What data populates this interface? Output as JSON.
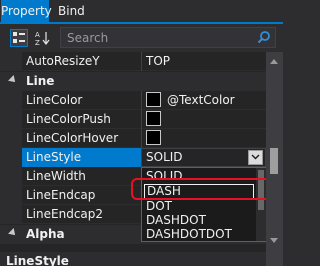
{
  "tabs": [
    {
      "label": "Property",
      "active": true
    },
    {
      "label": "Bind",
      "active": false
    }
  ],
  "toolbar": {
    "categorized_icon": "categorized-view-icon",
    "alphabetical_icon": "sort-alphabetical-icon",
    "search_placeholder": "Search",
    "search_icon": "search-icon"
  },
  "rows": {
    "autoresize": {
      "name": "AutoResizeY",
      "value": "TOP"
    },
    "line_category": {
      "name": "Line"
    },
    "linecolor": {
      "name": "LineColor",
      "value": "@TextColor"
    },
    "linecolorpush": {
      "name": "LineColorPush"
    },
    "linecolorhover": {
      "name": "LineColorHover"
    },
    "linestyle": {
      "name": "LineStyle",
      "value": "SOLID"
    },
    "linewidth": {
      "name": "LineWidth"
    },
    "lineendcap": {
      "name": "LineEndcap"
    },
    "lineendcap2": {
      "name": "LineEndcap2"
    },
    "alpha_category": {
      "name": "Alpha"
    },
    "partial": {
      "name": "LineStyle"
    }
  },
  "dropdown": {
    "options": [
      "SOLID",
      "DASH",
      "DOT",
      "DASHDOT",
      "DASHDOTDOT"
    ],
    "highlighted": "DASH"
  },
  "colors": {
    "accent": "#007acc",
    "background": "#252526",
    "annotation": "#e81123"
  }
}
